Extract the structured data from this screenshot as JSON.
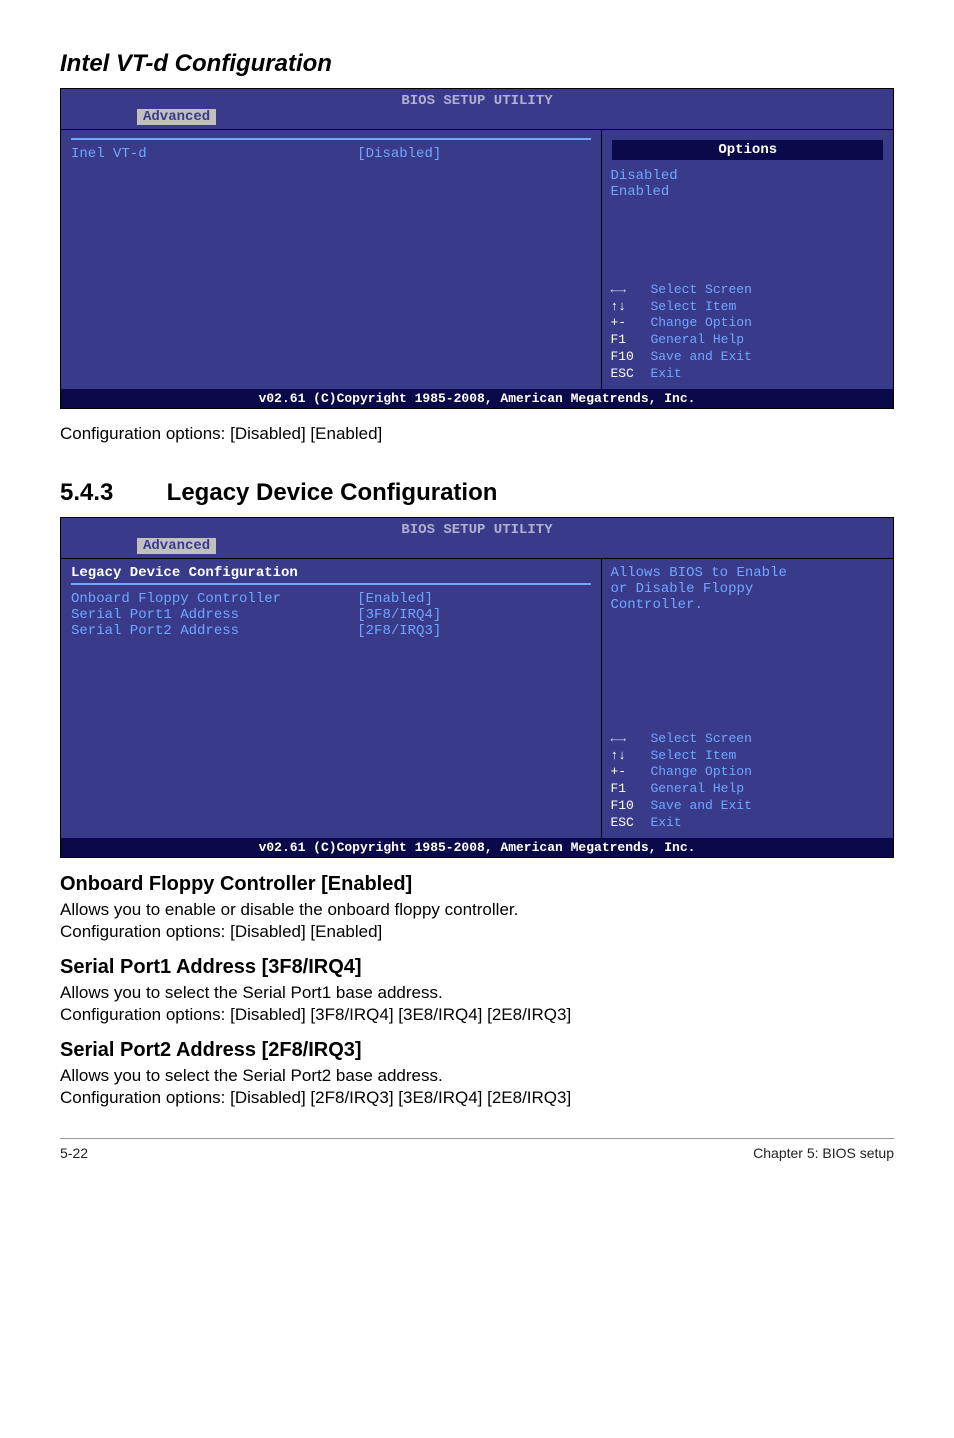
{
  "page": {
    "section1_title": "Intel VT-d Configuration",
    "section1_desc": "Configuration options: [Disabled] [Enabled]",
    "section2_num": "5.4.3",
    "section2_title": "Legacy Device Configuration",
    "sub1_title": "Onboard Floppy Controller [Enabled]",
    "sub1_line1": "Allows you to enable or disable the onboard floppy controller.",
    "sub1_line2": "Configuration options: [Disabled] [Enabled]",
    "sub2_title": "Serial Port1 Address [3F8/IRQ4]",
    "sub2_line1": "Allows you to select the Serial Port1 base address.",
    "sub2_line2": "Configuration options: [Disabled] [3F8/IRQ4] [3E8/IRQ4] [2E8/IRQ3]",
    "sub3_title": "Serial Port2 Address [2F8/IRQ3]",
    "sub3_line1": "Allows you to select the Serial Port2 base address.",
    "sub3_line2": "Configuration options: [Disabled] [2F8/IRQ3] [3E8/IRQ4] [2E8/IRQ3]",
    "footer_left": "5-22",
    "footer_right": "Chapter 5: BIOS setup"
  },
  "bios_common": {
    "header": "BIOS SETUP UTILITY",
    "tab": "Advanced",
    "footer": "v02.61 (C)Copyright 1985-2008, American Megatrends, Inc.",
    "nav": {
      "r1k": "←→",
      "r1t": "Select Screen",
      "r2k": "↑↓",
      "r2t": "Select Item",
      "r3k": "+-",
      "r3t": "Change Option",
      "r4k": "F1",
      "r4t": "General Help",
      "r5k": "F10",
      "r5t": "Save and Exit",
      "r6k": "ESC",
      "r6t": "Exit"
    }
  },
  "bios1": {
    "row1_label": "Inel VT-d",
    "row1_value": "[Disabled]",
    "options_title": "Options",
    "opt1": "Disabled",
    "opt2": "Enabled"
  },
  "bios2": {
    "panel_title": "Legacy Device Configuration",
    "rows": {
      "r1l": "Onboard Floppy Controller",
      "r1v": "[Enabled]",
      "r2l": "Serial Port1 Address",
      "r2v": "[3F8/IRQ4]",
      "r3l": "Serial Port2 Address",
      "r3v": "[2F8/IRQ3]"
    },
    "help1": "Allows BIOS to Enable",
    "help2": "or Disable Floppy",
    "help3": "Controller."
  }
}
